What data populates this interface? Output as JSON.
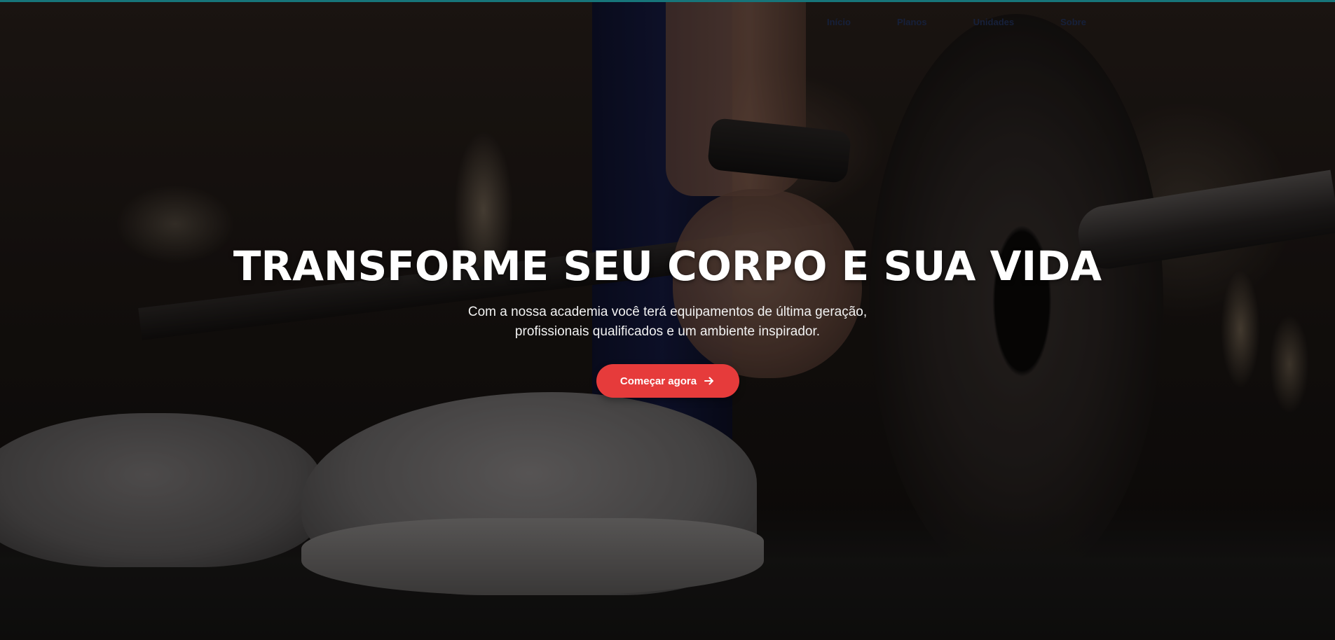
{
  "nav": {
    "items": [
      {
        "label": "Início"
      },
      {
        "label": "Planos"
      },
      {
        "label": "Unidades"
      },
      {
        "label": "Sobre"
      }
    ]
  },
  "hero": {
    "title": "TRANSFORME SEU CORPO E SUA VIDA",
    "subtitle_line1": "Com a nossa academia você terá equipamentos de última geração,",
    "subtitle_line2": "profissionais qualificados e um ambiente inspirador.",
    "cta_label": "Começar agora",
    "cta_icon": "arrow-right-icon"
  },
  "colors": {
    "accent_bar": "#17757a",
    "cta_background": "#e63b3b",
    "nav_text": "#16203a",
    "title_text": "#ffffff"
  }
}
